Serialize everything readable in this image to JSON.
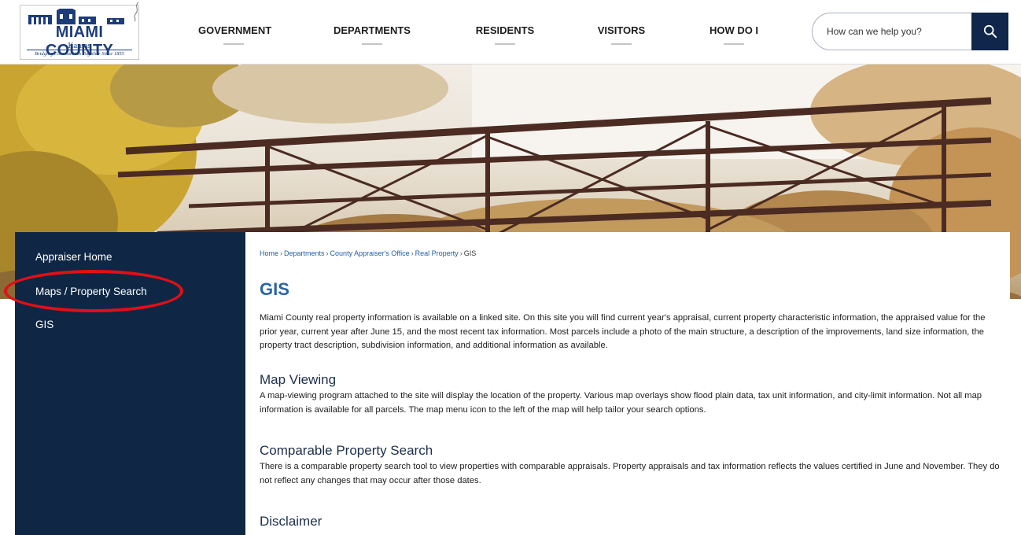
{
  "header": {
    "logo": {
      "name": "MIAMI COUNTY",
      "state": "Kansas",
      "tagline": "Bridging Communities Together Since 1855"
    },
    "nav": [
      {
        "label": "GOVERNMENT"
      },
      {
        "label": "DEPARTMENTS"
      },
      {
        "label": "RESIDENTS"
      },
      {
        "label": "VISITORS"
      },
      {
        "label": "HOW DO I"
      }
    ],
    "search": {
      "placeholder": "How can we help you?",
      "icon": "search-icon"
    }
  },
  "hero": {
    "image": "bridge-in-autumn-trees"
  },
  "sidebar": {
    "items": [
      {
        "label": "Appraiser Home"
      },
      {
        "label": "Maps / Property Search"
      },
      {
        "label": "GIS"
      }
    ],
    "highlight_color": "#e10f16"
  },
  "breadcrumb": {
    "items": [
      "Home",
      "Departments",
      "County Appraiser's Office",
      "Real Property"
    ],
    "separator": "›",
    "current": "GIS"
  },
  "main": {
    "title": "GIS",
    "intro": "Miami County real property information is available on a linked site. On this site you will find current year's appraisal, current property characteristic information, the appraised value for the prior year, current year after June 15, and the most recent tax information. Most parcels include a photo of the main structure, a description of the improvements, land size information, the property tract description, subdivision information, and additional information as available.",
    "sections": [
      {
        "heading": "Map Viewing",
        "body": "A map-viewing program attached to the site will display the location of the property. Various map overlays show flood plain data, tax unit information, and city-limit information. Not all map information is available for all parcels. The map menu icon to the left of the map will help tailor your search options."
      },
      {
        "heading": "Comparable Property Search",
        "body": "There is a comparable property search tool to view properties with comparable appraisals. Property appraisals and tax information reflects the values certified in June and November. They do not reflect any changes that may occur after those dates."
      },
      {
        "heading": "Disclaimer",
        "body": ""
      }
    ]
  },
  "colors": {
    "navy": "#0f2745",
    "title_blue": "#2a65a5",
    "link_blue": "#1f5ea8",
    "search_button": "#10264a"
  }
}
